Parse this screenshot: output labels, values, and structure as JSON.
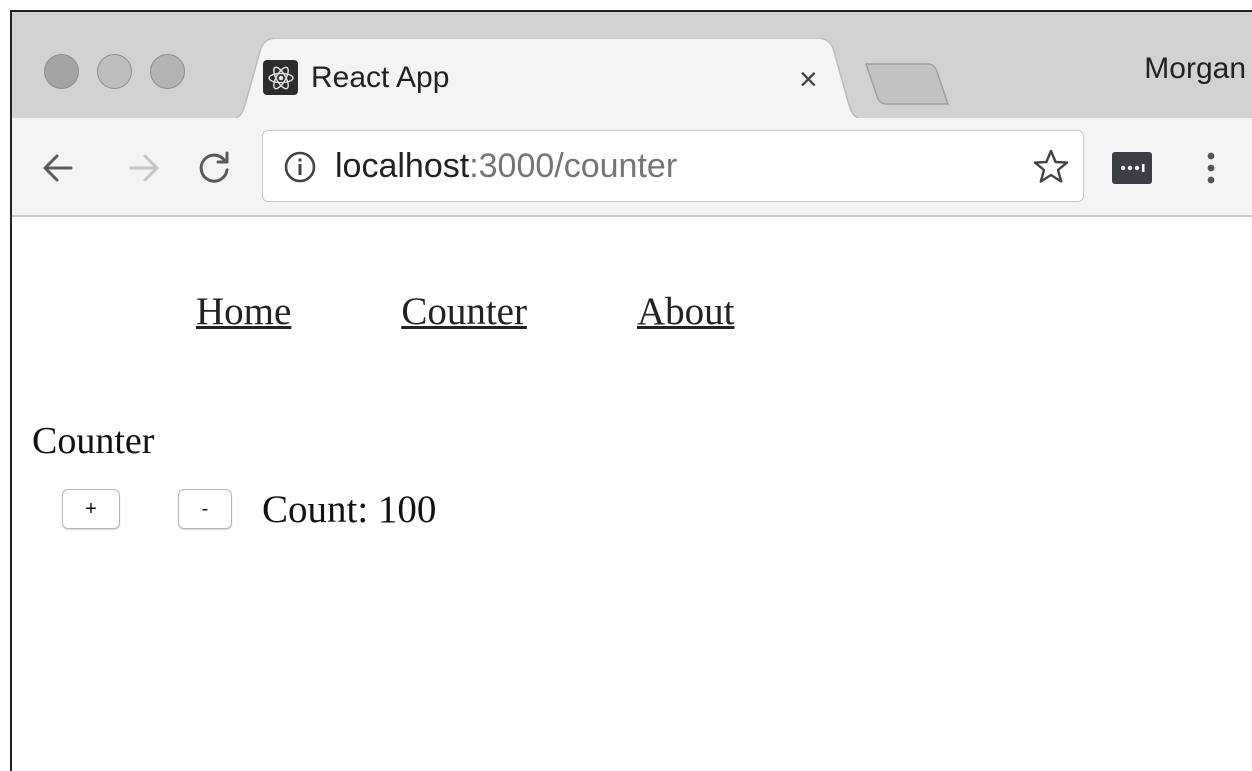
{
  "browser": {
    "tab": {
      "title": "React App",
      "close_glyph": "×",
      "favicon": "react-logo-icon"
    },
    "profile_name": "Morgan",
    "address": {
      "host": "localhost",
      "path": ":3000/counter"
    },
    "icons": [
      "back-arrow-icon",
      "forward-arrow-icon",
      "reload-icon",
      "info-icon",
      "star-icon",
      "extension-icon",
      "more-vert-icon"
    ]
  },
  "page": {
    "nav": {
      "home": "Home",
      "counter": "Counter",
      "about": "About"
    },
    "heading": "Counter",
    "increment_label": "+",
    "decrement_label": "-",
    "count_text": "Count: 100"
  }
}
